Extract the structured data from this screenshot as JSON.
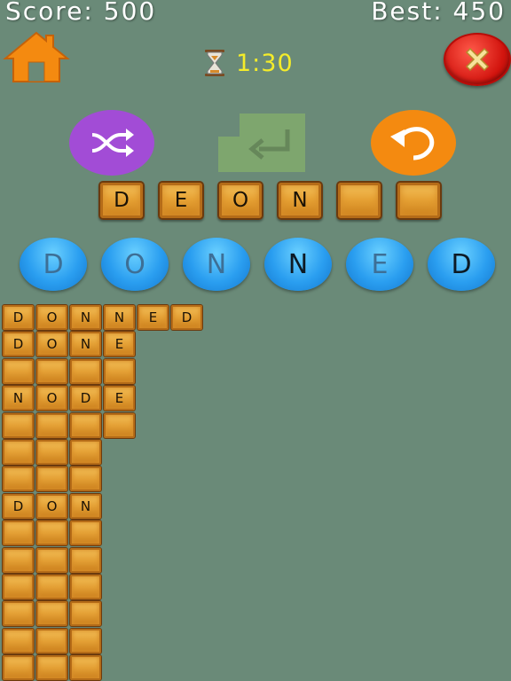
{
  "header": {
    "score_label": "Score: 500",
    "best_label": "Best: 450",
    "timer": "1:30"
  },
  "colors": {
    "background": "#6a8a78",
    "home": "#f48a10",
    "shuffle": "#a24cd6",
    "enter": "#7ea66e",
    "undo": "#f48a10",
    "close": "#d2140e",
    "timer_text": "#f4ec2a",
    "bubble": "#2a9ef0",
    "tile": "#e4a035"
  },
  "icons": {
    "home": "home-icon",
    "close": "close-icon",
    "shuffle": "shuffle-icon",
    "enter": "enter-icon",
    "undo": "undo-icon",
    "timer": "hourglass-icon"
  },
  "answer_slots": [
    "D",
    "E",
    "O",
    "N",
    "",
    ""
  ],
  "letters": [
    {
      "char": "D",
      "used": true
    },
    {
      "char": "O",
      "used": true
    },
    {
      "char": "N",
      "used": true
    },
    {
      "char": "N",
      "used": false
    },
    {
      "char": "E",
      "used": true
    },
    {
      "char": "D",
      "used": false
    }
  ],
  "word_grid": [
    [
      "D",
      "O",
      "N",
      "N",
      "E",
      "D"
    ],
    [
      "D",
      "O",
      "N",
      "E"
    ],
    [
      "",
      "",
      "",
      ""
    ],
    [
      "N",
      "O",
      "D",
      "E"
    ],
    [
      "",
      "",
      "",
      ""
    ],
    [
      "",
      "",
      ""
    ],
    [
      "",
      "",
      ""
    ],
    [
      "D",
      "O",
      "N"
    ],
    [
      "",
      "",
      ""
    ],
    [
      "",
      "",
      ""
    ],
    [
      "",
      "",
      ""
    ],
    [
      "",
      "",
      ""
    ],
    [
      "",
      "",
      ""
    ],
    [
      "",
      "",
      ""
    ]
  ]
}
